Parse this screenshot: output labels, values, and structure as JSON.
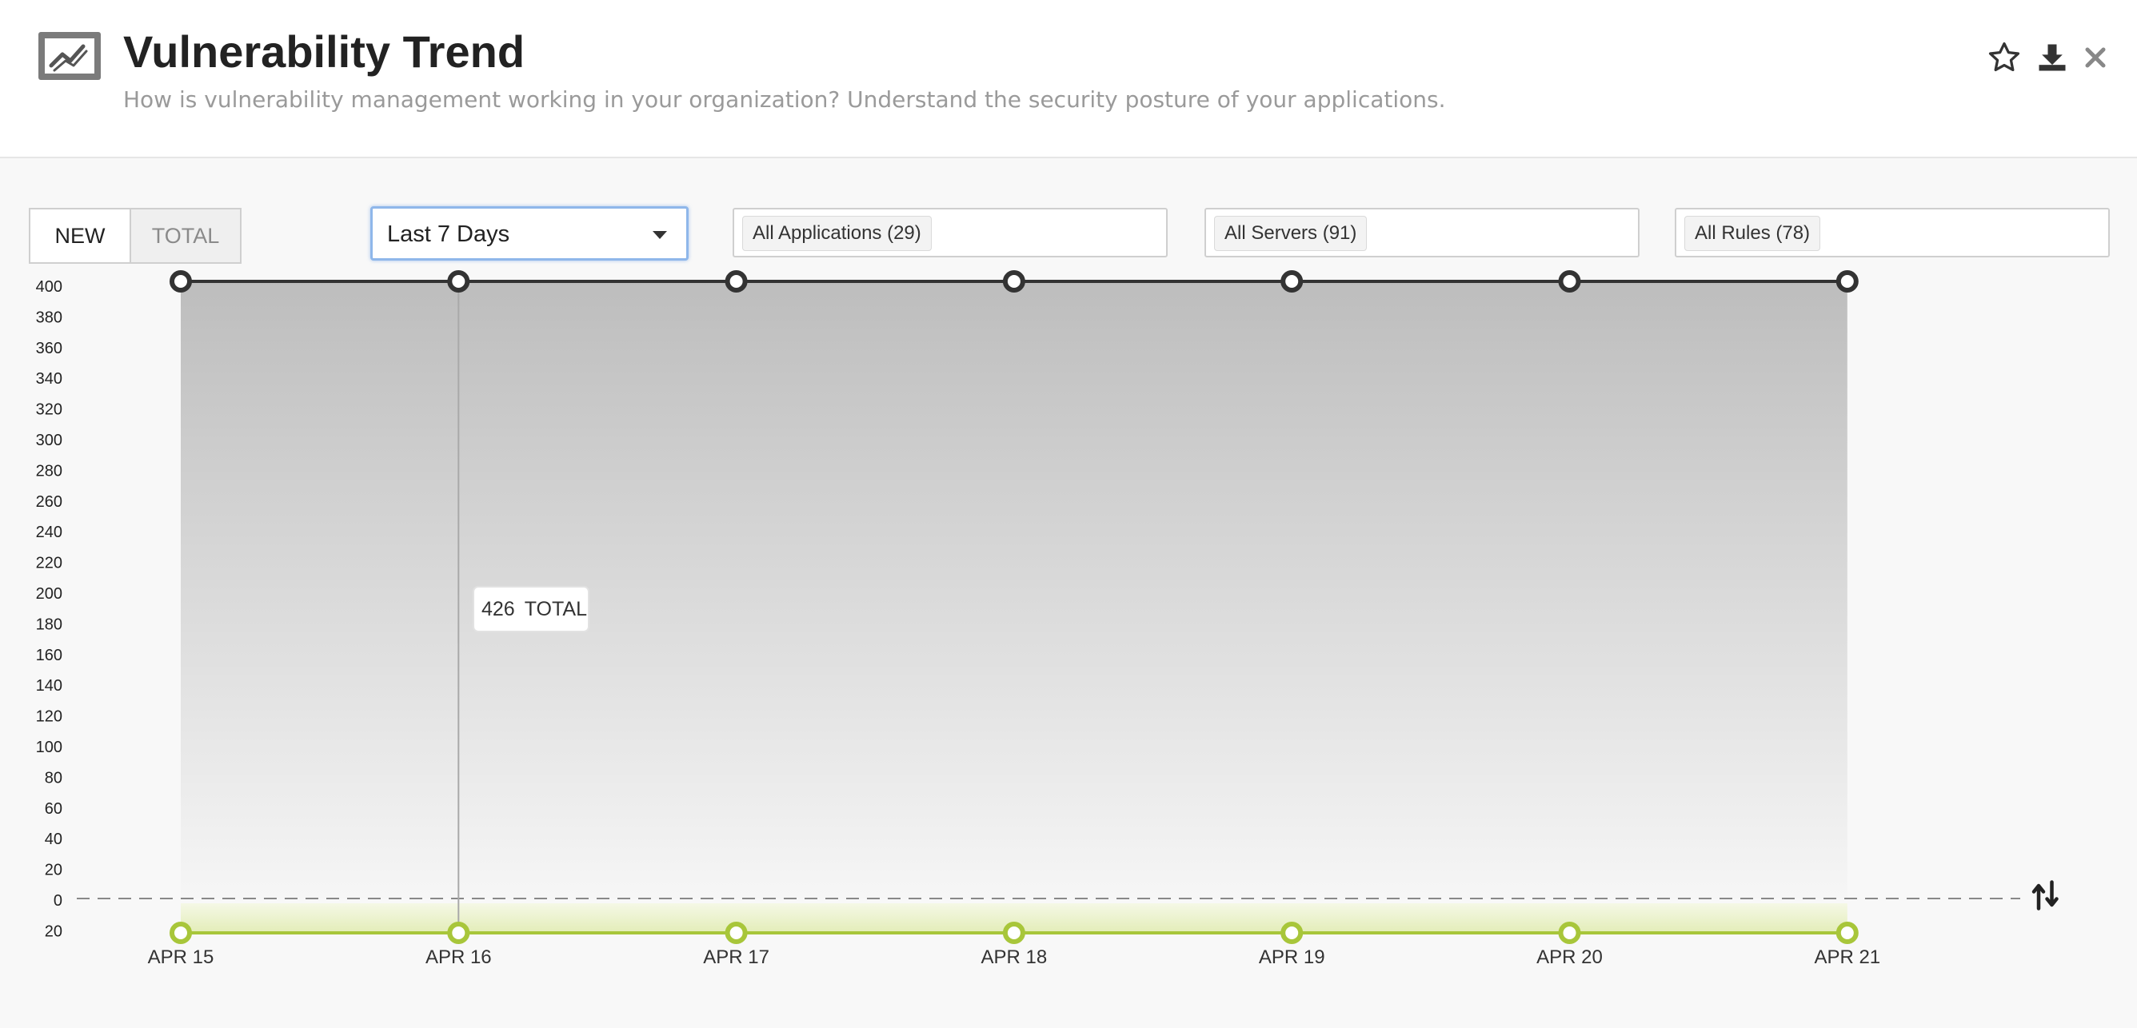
{
  "header": {
    "title": "Vulnerability Trend",
    "subtitle": "How is vulnerability management working in your organization? Understand the security posture of your applications.",
    "icon": "trend-chart-icon",
    "actions": [
      "star-icon",
      "download-icon",
      "close-icon"
    ]
  },
  "toggle": {
    "new_label": "NEW",
    "total_label": "TOTAL",
    "selected": "TOTAL"
  },
  "period_select": {
    "value": "Last 7 Days"
  },
  "filters": {
    "applications": "All Applications (29)",
    "servers": "All Servers (91)",
    "rules": "All Rules (78)"
  },
  "tooltip": {
    "value": "426",
    "label": "TOTAL"
  },
  "colors": {
    "total_line": "#333333",
    "new_line": "#a8c63a",
    "focus_border": "#8fb7ea"
  },
  "chart_data": {
    "type": "area",
    "x": [
      "APR 15",
      "APR 16",
      "APR 17",
      "APR 18",
      "APR 19",
      "APR 20",
      "APR 21"
    ],
    "yticks": [
      "400",
      "380",
      "360",
      "340",
      "320",
      "300",
      "280",
      "260",
      "240",
      "220",
      "200",
      "180",
      "160",
      "140",
      "120",
      "100",
      "80",
      "60",
      "40",
      "20",
      "0",
      "20"
    ],
    "ylim": [
      -20,
      400
    ],
    "grid": false,
    "series": [
      {
        "name": "TOTAL",
        "values": [
          426,
          426,
          426,
          426,
          426,
          426,
          426
        ],
        "color": "#333333"
      },
      {
        "name": "NEW",
        "values": [
          0,
          0,
          0,
          0,
          0,
          0,
          0
        ],
        "color": "#a8c63a"
      }
    ]
  }
}
